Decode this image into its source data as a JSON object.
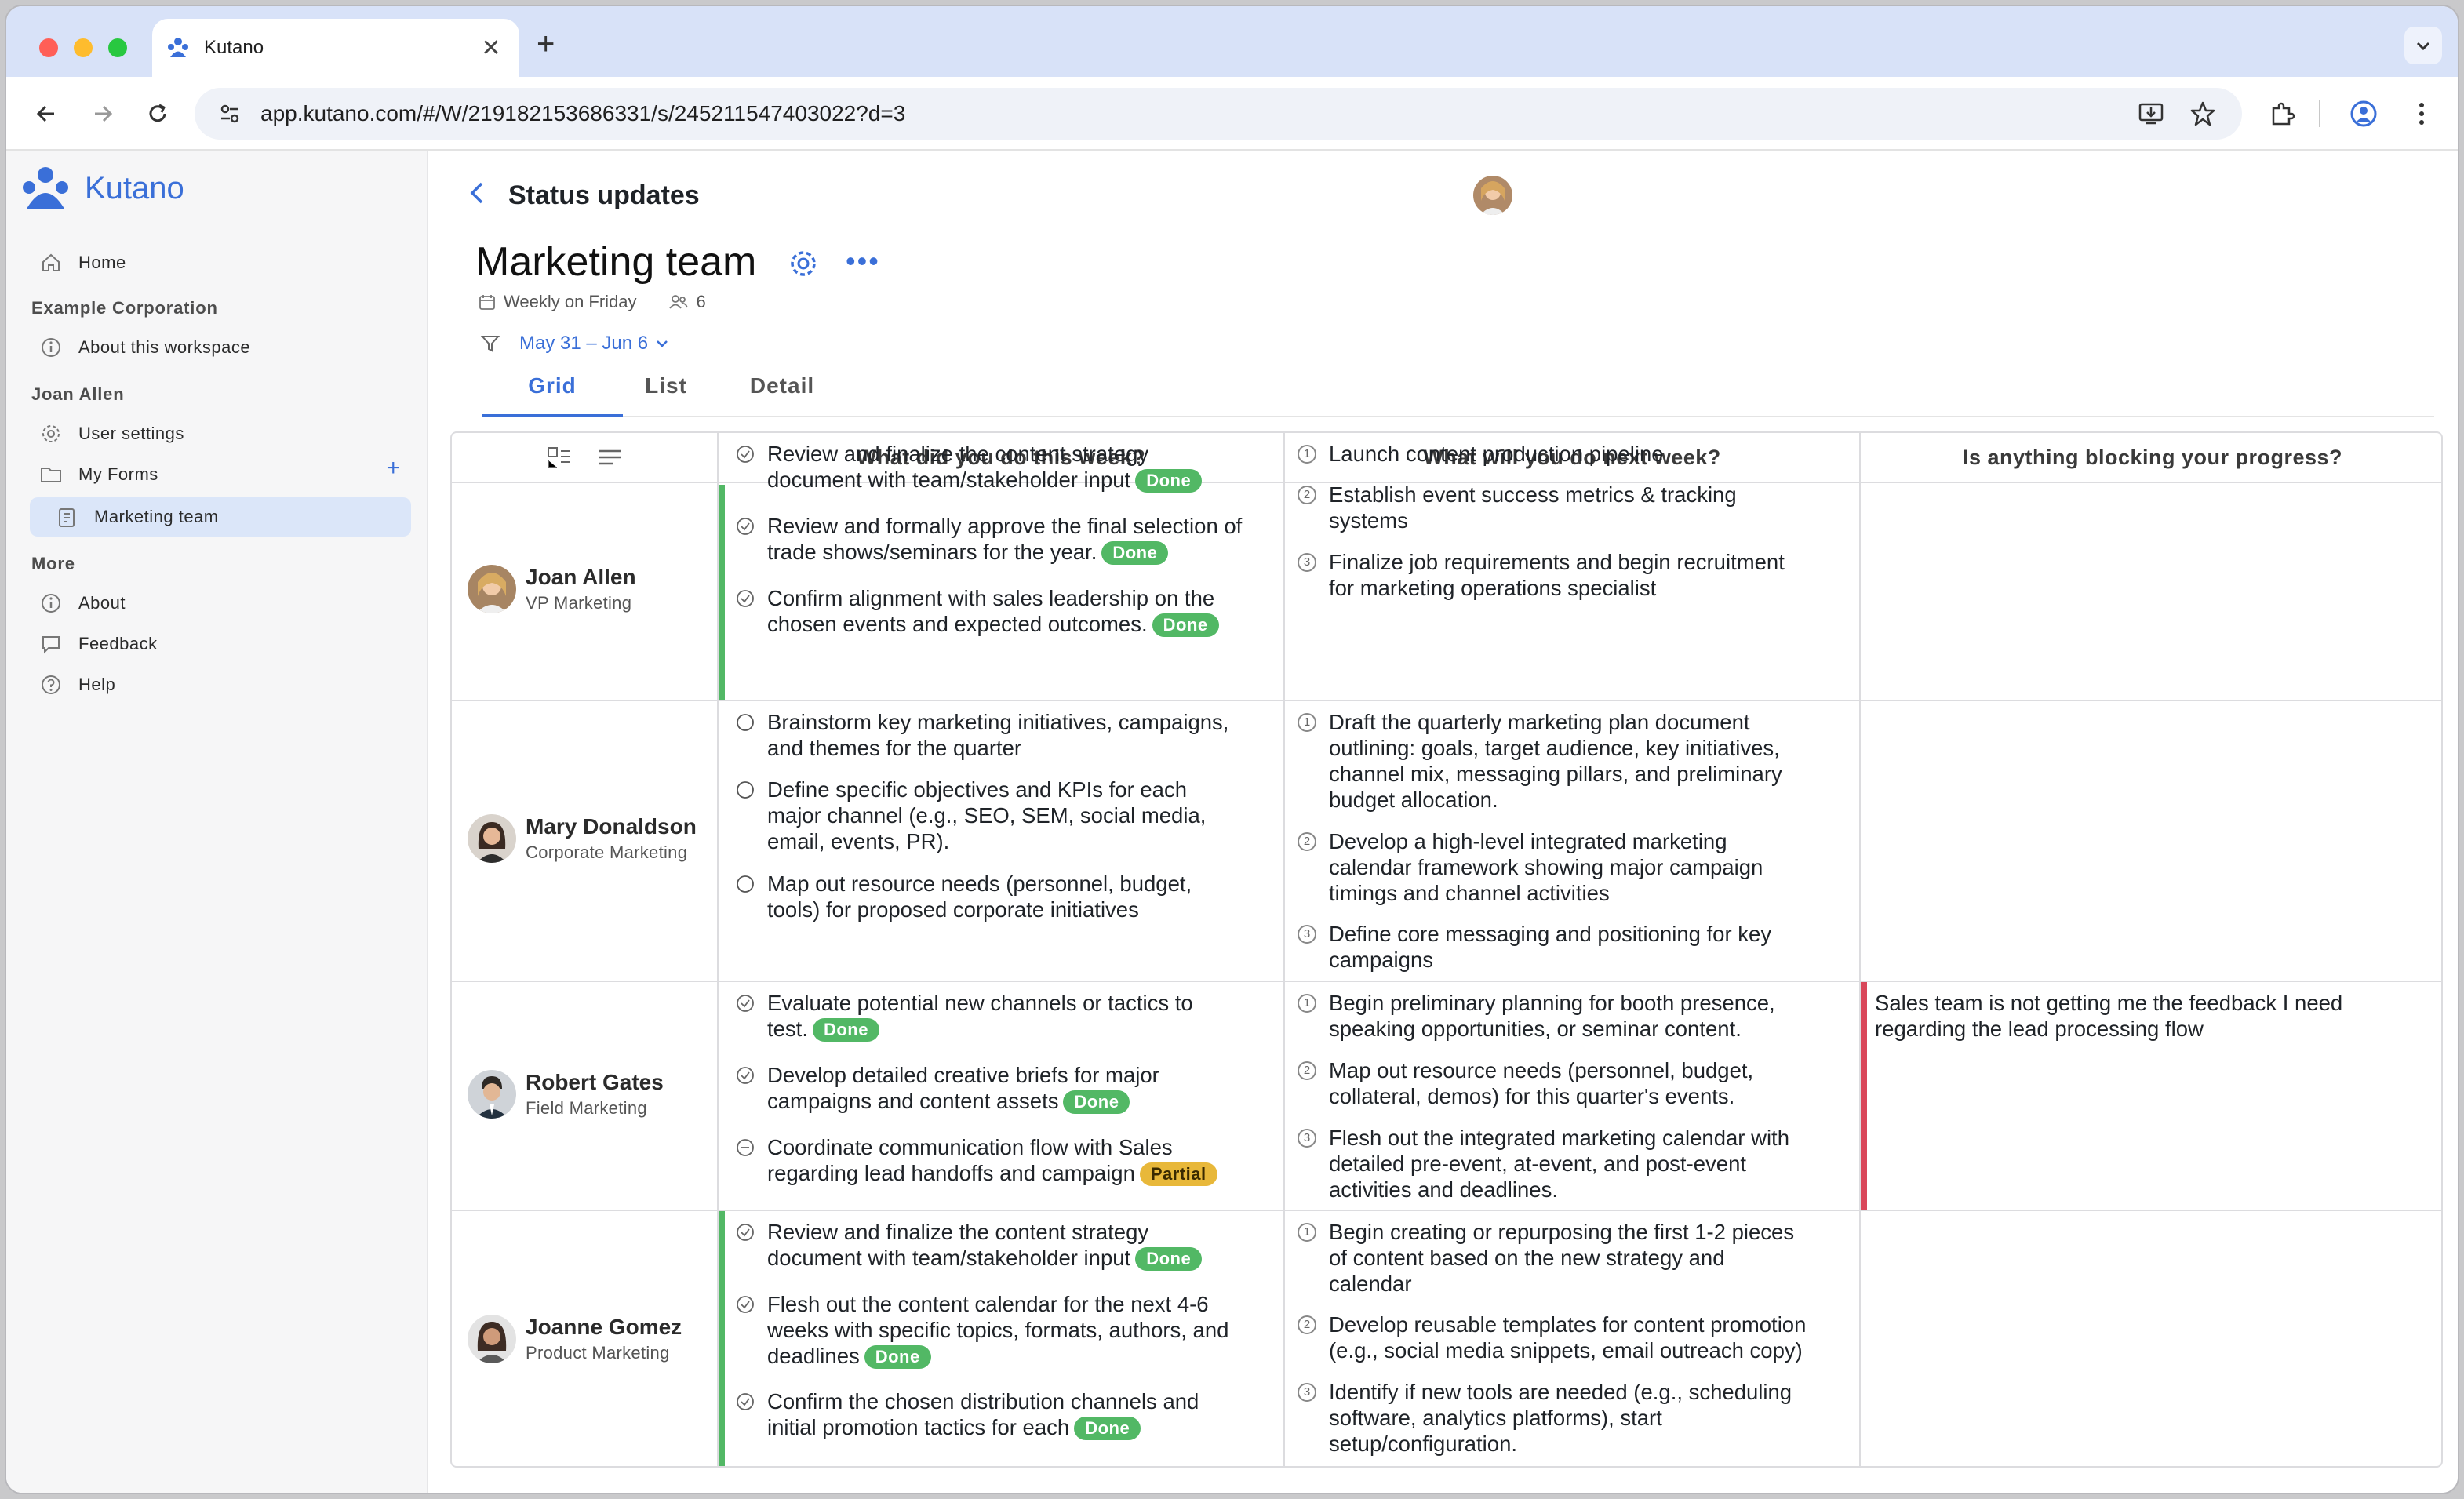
{
  "browser": {
    "tab_title": "Kutano",
    "url": "app.kutano.com/#/W/219182153686331/s/245211547403022?d=3"
  },
  "sidebar": {
    "brand": "Kutano",
    "home": "Home",
    "workspace_heading": "Example Corporation",
    "about_workspace": "About this workspace",
    "user_heading": "Joan Allen",
    "user_settings": "User settings",
    "my_forms": "My Forms",
    "current_form": "Marketing team",
    "more_heading": "More",
    "about": "About",
    "feedback": "Feedback",
    "help": "Help"
  },
  "header": {
    "page_title": "Status updates",
    "form_title": "Marketing team",
    "schedule": "Weekly on Friday",
    "member_count": "6",
    "date_range": "May 31 – Jun 6"
  },
  "tabs": [
    "Grid",
    "List",
    "Detail"
  ],
  "columns": [
    "What did you do this week?",
    "What will you do next week?",
    "Is anything blocking your progress?"
  ],
  "status_colors": {
    "done": "#52b865",
    "partial": "#e8b83a",
    "blocked": "#d9475a",
    "complete": "#52b865"
  },
  "rows": [
    {
      "name": "Joan Allen",
      "role": "VP Marketing",
      "this_week": [
        {
          "l1": "Review and finalize the content strategy",
          "l2": "document with team/stakeholder input",
          "badge": "Done"
        },
        {
          "l1": "Review and formally approve the final selection of",
          "l2": "trade shows/seminars for the year.",
          "badge": "Done"
        },
        {
          "l1": "Confirm alignment with sales leadership on the",
          "l2": "chosen events and expected outcomes.",
          "badge": "Done"
        }
      ],
      "next_week": [
        {
          "l1": "Launch content production pipeline"
        },
        {
          "l1": "Establish event success metrics & tracking",
          "l2": "systems"
        },
        {
          "l1": "Finalize job requirements and begin recruitment",
          "l2": "for marketing operations specialist"
        }
      ],
      "blocking": {
        "l1": "",
        "l2": ""
      }
    },
    {
      "name": "Mary Donaldson",
      "role": "Corporate Marketing",
      "this_week": [
        {
          "l1": "Brainstorm key marketing initiatives, campaigns,",
          "l2": "and themes for the quarter"
        },
        {
          "l1": "Define specific objectives and KPIs for each",
          "l2": "major channel (e.g., SEO, SEM, social media,",
          "l3": "email, events, PR)."
        },
        {
          "l1": "Map out resource needs (personnel, budget,",
          "l2": "tools) for proposed corporate initiatives"
        }
      ],
      "next_week": [
        {
          "l1": "Draft the quarterly marketing plan document",
          "l2": "outlining: goals, target audience, key initiatives,",
          "l3": "channel mix, messaging pillars, and preliminary",
          "l4": "budget allocation."
        },
        {
          "l1": "Develop a high-level integrated marketing",
          "l2": "calendar framework showing major campaign",
          "l3": "timings and channel activities"
        },
        {
          "l1": "Define core messaging and positioning for key",
          "l2": "campaigns"
        }
      ],
      "blocking": {
        "l1": "",
        "l2": ""
      }
    },
    {
      "name": "Robert Gates",
      "role": "Field Marketing",
      "this_week": [
        {
          "l1": "Evaluate potential new channels or tactics to",
          "l2": "test.",
          "badge": "Done"
        },
        {
          "l1": "Develop detailed creative briefs for major",
          "l2": "campaigns and content assets",
          "badge": "Done"
        },
        {
          "l1": "Coordinate communication flow with Sales",
          "l2": "regarding lead handoffs and campaign",
          "badge": "Partial"
        }
      ],
      "next_week": [
        {
          "l1": "Begin preliminary planning for booth presence,",
          "l2": "speaking opportunities, or seminar content."
        },
        {
          "l1": "Map out resource needs (personnel, budget,",
          "l2": "collateral, demos) for this quarter's events."
        },
        {
          "l1": "Flesh out the integrated marketing calendar with",
          "l2": "detailed pre-event, at-event, and post-event",
          "l3": "activities and deadlines."
        }
      ],
      "blocking": {
        "l1": "Sales team is not getting me the feedback I need",
        "l2": "regarding the lead processing flow"
      }
    },
    {
      "name": "Joanne Gomez",
      "role": "Product Marketing",
      "this_week": [
        {
          "l1": "Review and finalize the content strategy",
          "l2": "document with team/stakeholder input",
          "badge": "Done"
        },
        {
          "l1": "Flesh out the content calendar for the next 4-6",
          "l2": "weeks with specific topics, formats, authors, and",
          "l3": "deadlines",
          "badge": "Done"
        },
        {
          "l1": "Confirm the chosen distribution channels and",
          "l2": "initial promotion tactics for each",
          "badge": "Done"
        }
      ],
      "next_week": [
        {
          "l1": "Begin creating or repurposing the first 1-2 pieces",
          "l2": "of content based on the new strategy and",
          "l3": "calendar"
        },
        {
          "l1": "Develop reusable templates for content promotion",
          "l2": "(e.g., social media snippets, email outreach copy)"
        },
        {
          "l1": "Identify if new tools are needed (e.g., scheduling",
          "l2": "software, analytics platforms), start",
          "l3": "setup/configuration."
        }
      ],
      "blocking": {
        "l1": "",
        "l2": ""
      }
    }
  ]
}
